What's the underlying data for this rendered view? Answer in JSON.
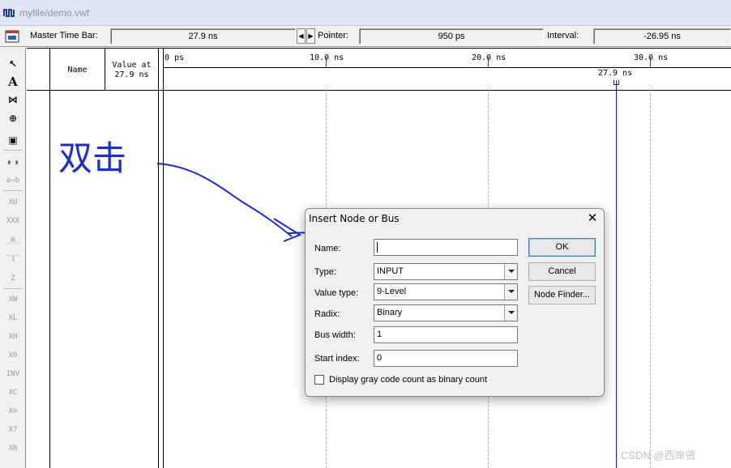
{
  "window": {
    "title": "myfile/demo.vwf"
  },
  "toolbar": {
    "master_time_bar_label": "Master Time Bar:",
    "master_time_bar_value": "27.9 ns",
    "pointer_label": "Pointer:",
    "pointer_value": "950 ps",
    "interval_label": "Interval:",
    "interval_value": "-26.95 ns"
  },
  "palette": {
    "tools": [
      "selection-tool",
      "text-tool",
      "waveform-editing-tool",
      "zoom-tool",
      "full-screen-tool",
      "find-tool",
      "replace-tool",
      "uninitialized-tool",
      "unknown-tool",
      "force-low-tool",
      "force-high-tool",
      "high-impedance-tool",
      "weak-unknown-tool",
      "weak-low-tool",
      "weak-high-tool",
      "invert-tool",
      "count-value-tool",
      "clock-tool",
      "arbitrary-value-tool",
      "random-value-tool"
    ]
  },
  "waveform": {
    "name_header": "Name",
    "value_header_line1": "Value at",
    "value_header_line2": "27.9 ns",
    "ticks": [
      "0 ps",
      "10.0 ns",
      "20.0 ns",
      "30.0 ns"
    ],
    "cursor_label": "27.9 ns"
  },
  "annotation": {
    "text": "双击"
  },
  "dialog": {
    "title": "Insert Node or Bus",
    "name_label": "Name:",
    "name_value": "",
    "type_label": "Type:",
    "type_value": "INPUT",
    "value_type_label": "Value type:",
    "value_type_value": "9-Level",
    "radix_label": "Radix:",
    "radix_value": "Binary",
    "bus_width_label": "Bus width:",
    "bus_width_value": "1",
    "start_index_label": "Start index:",
    "start_index_value": "0",
    "checkbox_label": "Display gray code count as binary count",
    "checkbox_checked": false,
    "ok_label": "OK",
    "cancel_label": "Cancel",
    "node_finder_label": "Node Finder..."
  },
  "watermark": "CSDN @西岸贤"
}
